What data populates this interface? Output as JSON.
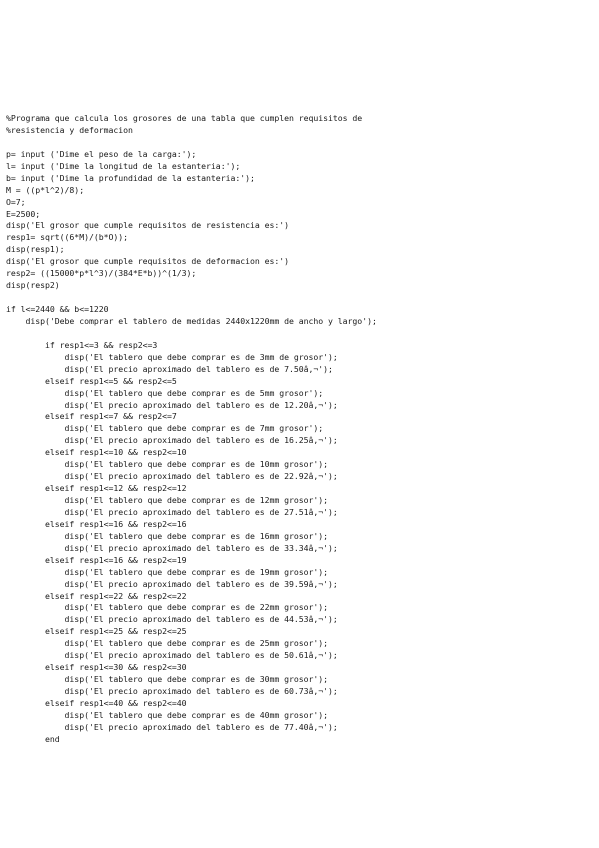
{
  "lines": [
    "%Programa que calcula los grosores de una tabla que cumplen requisitos de",
    "%resistencia y deformacion",
    "",
    "p= input ('Dime el peso de la carga:');",
    "l= input ('Dime la longitud de la estanteria:');",
    "b= input ('Dime la profundidad de la estanteria:');",
    "M = ((p*l^2)/8);",
    "O=7;",
    "E=2500;",
    "disp('El grosor que cumple requisitos de resistencia es:')",
    "resp1= sqrt((6*M)/(b*O));",
    "disp(resp1);",
    "disp('El grosor que cumple requisitos de deformacion es:')",
    "resp2= ((15000*p*l^3)/(384*E*b))^(1/3);",
    "disp(resp2)",
    "",
    "if l<=2440 && b<=1220",
    "    disp('Debe comprar el tablero de medidas 2440x1220mm de ancho y largo');",
    "",
    "        if resp1<=3 && resp2<=3",
    "            disp('El tablero que debe comprar es de 3mm de grosor');",
    "            disp('El precio aproximado del tablero es de 7.50â,¬');",
    "        elseif resp1<=5 && resp2<=5",
    "            disp('El tablero que debe comprar es de 5mm grosor');",
    "            disp('El precio aproximado del tablero es de 12.20â,¬');",
    "        elseif resp1<=7 && resp2<=7",
    "            disp('El tablero que debe comprar es de 7mm grosor');",
    "            disp('El precio aproximado del tablero es de 16.25â,¬');",
    "        elseif resp1<=10 && resp2<=10",
    "            disp('El tablero que debe comprar es de 10mm grosor');",
    "            disp('El precio aproximado del tablero es de 22.92â,¬');",
    "        elseif resp1<=12 && resp2<=12",
    "            disp('El tablero que debe comprar es de 12mm grosor');",
    "            disp('El precio aproximado del tablero es de 27.51â,¬');",
    "        elseif resp1<=16 && resp2<=16",
    "            disp('El tablero que debe comprar es de 16mm grosor');",
    "            disp('El precio aproximado del tablero es de 33.34â,¬');",
    "        elseif resp1<=16 && resp2<=19",
    "            disp('El tablero que debe comprar es de 19mm grosor');",
    "            disp('El precio aproximado del tablero es de 39.59â,¬');",
    "        elseif resp1<=22 && resp2<=22",
    "            disp('El tablero que debe comprar es de 22mm grosor');",
    "            disp('El precio aproximado del tablero es de 44.53â,¬');",
    "        elseif resp1<=25 && resp2<=25",
    "            disp('El tablero que debe comprar es de 25mm grosor');",
    "            disp('El precio aproximado del tablero es de 50.61â,¬');",
    "        elseif resp1<=30 && resp2<=30",
    "            disp('El tablero que debe comprar es de 30mm grosor');",
    "            disp('El precio aproximado del tablero es de 60.73â,¬');",
    "        elseif resp1<=40 && resp2<=40",
    "            disp('El tablero que debe comprar es de 40mm grosor');",
    "            disp('El precio aproximado del tablero es de 77.40â,¬');",
    "        end"
  ]
}
